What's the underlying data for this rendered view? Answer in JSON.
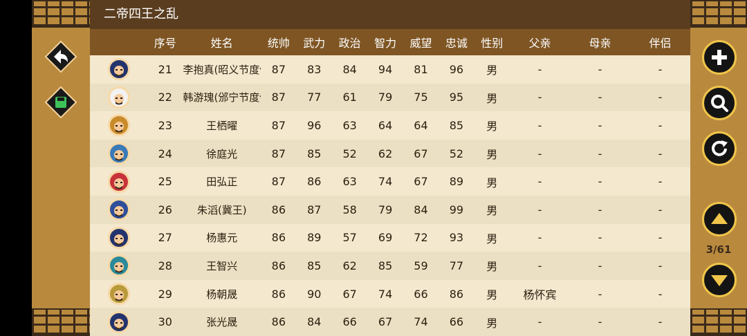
{
  "title": "二帝四王之乱",
  "columns": [
    "序号",
    "姓名",
    "统帅",
    "武力",
    "政治",
    "智力",
    "威望",
    "忠诚",
    "性别",
    "父亲",
    "母亲",
    "伴侣"
  ],
  "rows": [
    {
      "id": "21",
      "name": "李抱真(昭义节度使)",
      "cmd": "87",
      "str": "83",
      "pol": "84",
      "int": "94",
      "pres": "81",
      "loy": "96",
      "gender": "男",
      "father": "-",
      "mother": "-",
      "spouse": "-",
      "hat": "#23336e"
    },
    {
      "id": "22",
      "name": "韩游瑰(邠宁节度使)",
      "cmd": "87",
      "str": "77",
      "pol": "61",
      "int": "79",
      "pres": "75",
      "loy": "95",
      "gender": "男",
      "father": "-",
      "mother": "-",
      "spouse": "-",
      "hat": "#f2f2f2"
    },
    {
      "id": "23",
      "name": "王栖曜",
      "cmd": "87",
      "str": "96",
      "pol": "63",
      "int": "64",
      "pres": "64",
      "loy": "85",
      "gender": "男",
      "father": "-",
      "mother": "-",
      "spouse": "-",
      "hat": "#c98a2a"
    },
    {
      "id": "24",
      "name": "徐庭光",
      "cmd": "87",
      "str": "85",
      "pol": "52",
      "int": "62",
      "pres": "67",
      "loy": "52",
      "gender": "男",
      "father": "-",
      "mother": "-",
      "spouse": "-",
      "hat": "#3a7ab8"
    },
    {
      "id": "25",
      "name": "田弘正",
      "cmd": "87",
      "str": "86",
      "pol": "63",
      "int": "74",
      "pres": "67",
      "loy": "89",
      "gender": "男",
      "father": "-",
      "mother": "-",
      "spouse": "-",
      "hat": "#c8323a"
    },
    {
      "id": "26",
      "name": "朱滔(冀王)",
      "cmd": "86",
      "str": "87",
      "pol": "58",
      "int": "79",
      "pres": "84",
      "loy": "99",
      "gender": "男",
      "father": "-",
      "mother": "-",
      "spouse": "-",
      "hat": "#2e4f9a"
    },
    {
      "id": "27",
      "name": "杨惠元",
      "cmd": "86",
      "str": "89",
      "pol": "57",
      "int": "69",
      "pres": "72",
      "loy": "93",
      "gender": "男",
      "father": "-",
      "mother": "-",
      "spouse": "-",
      "hat": "#23336e"
    },
    {
      "id": "28",
      "name": "王智兴",
      "cmd": "86",
      "str": "85",
      "pol": "62",
      "int": "85",
      "pres": "59",
      "loy": "77",
      "gender": "男",
      "father": "-",
      "mother": "-",
      "spouse": "-",
      "hat": "#2a8a9a"
    },
    {
      "id": "29",
      "name": "杨朝晟",
      "cmd": "86",
      "str": "90",
      "pol": "67",
      "int": "74",
      "pres": "66",
      "loy": "86",
      "gender": "男",
      "father": "杨怀宾",
      "mother": "-",
      "spouse": "-",
      "hat": "#b89a3a"
    },
    {
      "id": "30",
      "name": "张光晟",
      "cmd": "86",
      "str": "84",
      "pol": "66",
      "int": "67",
      "pres": "74",
      "loy": "66",
      "gender": "男",
      "father": "-",
      "mother": "-",
      "spouse": "-",
      "hat": "#23336e"
    }
  ],
  "pager": {
    "text": "3/61"
  },
  "colors": {
    "frame": "#b98a3e",
    "title_bar": "#5a3d1f",
    "header": "#7e5523",
    "row_a": "#f4e8cf",
    "row_b": "#ece0c4",
    "button_ring": "#f0c54a"
  }
}
